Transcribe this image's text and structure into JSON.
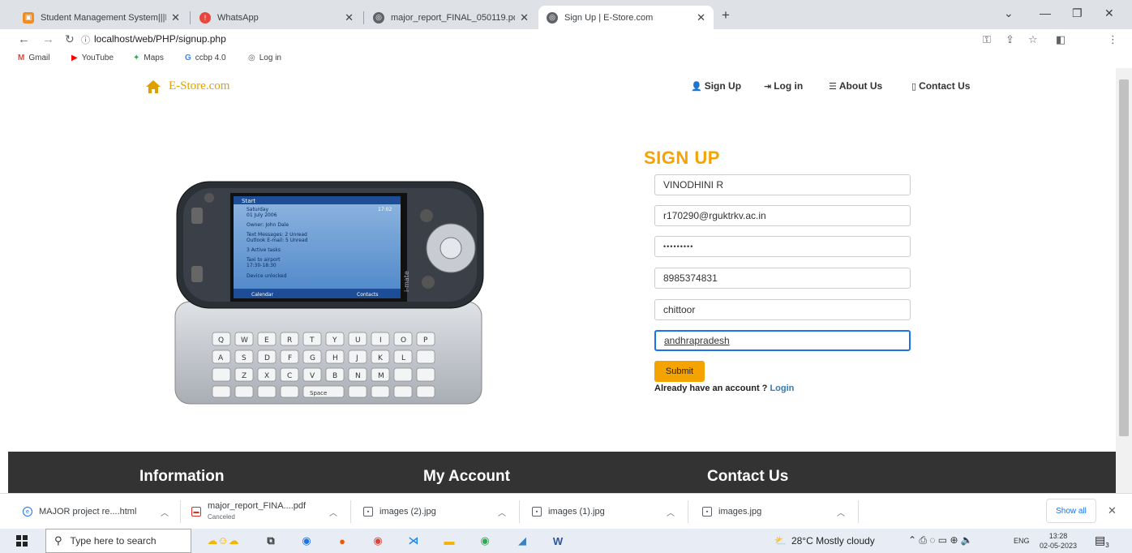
{
  "browser": {
    "tabs": [
      {
        "title": "Student Management System|||D",
        "favicon": "student-favicon",
        "favicon_color": "#f28b20"
      },
      {
        "title": "WhatsApp",
        "favicon": "whatsapp-favicon",
        "favicon_color": "#e8453c"
      },
      {
        "title": "major_report_FINAL_050119.pdf",
        "favicon": "globe-favicon",
        "favicon_color": "#5f6368"
      },
      {
        "title": "Sign Up | E-Store.com",
        "favicon": "globe-favicon",
        "favicon_color": "#5f6368",
        "active": true
      }
    ],
    "new_tab": "+",
    "url": "localhost/web/PHP/signup.php",
    "bookmarks": [
      {
        "label": "Gmail",
        "icon": "gmail-icon",
        "color": "#ea4335"
      },
      {
        "label": "YouTube",
        "icon": "youtube-icon",
        "color": "#ff0000"
      },
      {
        "label": "Maps",
        "icon": "maps-icon",
        "color": "#34a853"
      },
      {
        "label": "ccbp 4.0",
        "icon": "google-icon",
        "color": "#4285f4"
      },
      {
        "label": "Log in",
        "icon": "globe-icon",
        "color": "#5f6368"
      }
    ]
  },
  "site": {
    "brand": "E-Store.com",
    "brand_color": "#e0a100",
    "nav": [
      {
        "label": "Sign Up",
        "icon": "user-icon"
      },
      {
        "label": "Log in",
        "icon": "login-icon"
      },
      {
        "label": "About Us",
        "icon": "list-icon"
      },
      {
        "label": "Contact Us",
        "icon": "phone-icon"
      }
    ]
  },
  "form": {
    "title": "SIGN UP",
    "title_color": "#f5a300",
    "fields": {
      "name": "VINODHINI R",
      "email": "r170290@rguktrkv.ac.in",
      "password": "•••••••••",
      "phone": "8985374831",
      "city": "chittoor",
      "state": "andhrapradesh"
    },
    "submit_label": "Submit",
    "already_text": "Already have an account ?",
    "login_label": "Login"
  },
  "phone_screen": {
    "start": "Start",
    "time": "17:02",
    "day": "Saturday",
    "date": "01 July 2006",
    "owner": "Owner: John Dale",
    "messages": "Text Messages: 2 Unread",
    "email": "Outlook E-mail: 5 Unread",
    "tasks": "3 Active tasks",
    "appt": "Taxi to airport",
    "appt_time": "17:30-18:30",
    "device": "Device unlocked",
    "soft_left": "Calendar",
    "soft_right": "Contacts",
    "brand": "i-mate"
  },
  "footer": {
    "col1": "Information",
    "col2": "My Account",
    "col3": "Contact Us"
  },
  "downloads": {
    "items": [
      {
        "name": "MAJOR project re....html",
        "sub": ""
      },
      {
        "name": "major_report_FINA....pdf",
        "sub": "Canceled"
      },
      {
        "name": "images (2).jpg",
        "sub": ""
      },
      {
        "name": "images (1).jpg",
        "sub": ""
      },
      {
        "name": "images.jpg",
        "sub": ""
      }
    ],
    "show_all": "Show all"
  },
  "taskbar": {
    "search_placeholder": "Type here to search",
    "weather": "28°C  Mostly cloudy",
    "lang": "ENG",
    "time": "13:28",
    "date": "02-05-2023",
    "notifications": "3"
  }
}
